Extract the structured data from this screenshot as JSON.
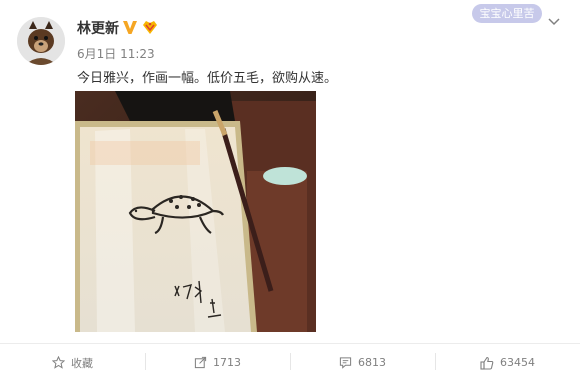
{
  "post": {
    "username": "林更新",
    "timestamp": "6月1日 11:23",
    "text": "今日雅兴，作画一幅。低价五毛，欲购从速。",
    "badge_text": "宝宝心里苦"
  },
  "actions": {
    "favorite_label": "收藏",
    "share_count": "1713",
    "comment_count": "6813",
    "like_count": "63454"
  },
  "colors": {
    "verified": "#f5a623",
    "badge": "#c7c9ea",
    "muted_text": "#808080"
  },
  "icons": [
    "verified-icon",
    "vip-icon",
    "chevron-down-icon",
    "star-icon",
    "share-icon",
    "comment-icon",
    "like-icon"
  ]
}
